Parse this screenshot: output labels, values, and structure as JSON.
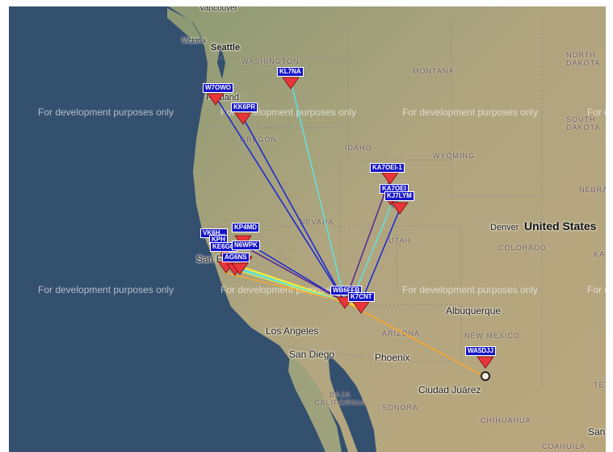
{
  "watermark": "For development purposes only",
  "colors": {
    "ocean": "#34506f",
    "land": "#a89e7c",
    "marker": "#e8363a",
    "tag_bg": "#1414c8",
    "path_blue": "#1d2bd1",
    "path_cyan": "#61e0d8",
    "path_purple": "#5b2c8f",
    "path_yellow": "#f4ea3a",
    "path_orange": "#f3a63a"
  },
  "places": {
    "vancouver": "Vancouver",
    "victoria": "Victoria",
    "seattle": "Seattle",
    "portland": "Portland",
    "los_angeles": "Los Angeles",
    "san_diego": "San Diego",
    "phoenix": "Phoenix",
    "albuquerque": "Albuquerque",
    "denver": "Denver",
    "ciudad_juarez": "Ciudad Juárez",
    "san_fr": "San F",
    "san_antonio": "San",
    "country": "United States"
  },
  "regions": {
    "washington": "WASHINGTON",
    "oregon": "OREGON",
    "idaho": "IDAHO",
    "montana": "MONTANA",
    "wyoming": "WYOMING",
    "nevada": "NEVADA",
    "utah": "UTAH",
    "colorado": "COLORADO",
    "arizona": "ARIZONA",
    "new_mexico": "NEW MEXICO",
    "baja_california": "BAJA\nCALIFORNIA",
    "sonora": "SONORA",
    "chihuahua": "CHIHUAHUA",
    "coahuila": "COAHUILA",
    "north_dakota": "NORTH\nDAKOTA",
    "south_dakota": "SOUTH\nDAKOTA",
    "nebraska": "NEBRA",
    "kansas": "KA",
    "texas": "TEX"
  },
  "stations": [
    {
      "id": "W7OWO"
    },
    {
      "id": "KL7NA"
    },
    {
      "id": "KK6PR"
    },
    {
      "id": "KA7OEI-1"
    },
    {
      "id": "KA7OEI"
    },
    {
      "id": "KJ7LYM"
    },
    {
      "id": "KP4MD"
    },
    {
      "id": "VK6..."
    },
    {
      "id": "KPH"
    },
    {
      "id": "KE6GC"
    },
    {
      "id": "N6WPK"
    },
    {
      "id": "AG6NS"
    },
    {
      "id": "WB6FFB"
    },
    {
      "id": "K7CNT"
    },
    {
      "id": "WA5DJJ"
    }
  ],
  "station_labels": {
    "w7owo": "W7OWO",
    "kl7na": "KL7NA",
    "kk6pr": "KK6PR",
    "ka7oei1": "KA7OEI-1",
    "ka7oei": "KA7OEI",
    "kj7lym": "KJ7LYM",
    "kp4md": "KP4MD",
    "vk": "VK6H...",
    "kph": "KPH",
    "ke6gc": "KE6GC",
    "n6wpk": "N6WPK",
    "ag6ns": "AG6NS",
    "wb6ffb": "WB6FFB",
    "k7cnt": "K7CNT",
    "wa5djj": "WA5DJJ"
  }
}
